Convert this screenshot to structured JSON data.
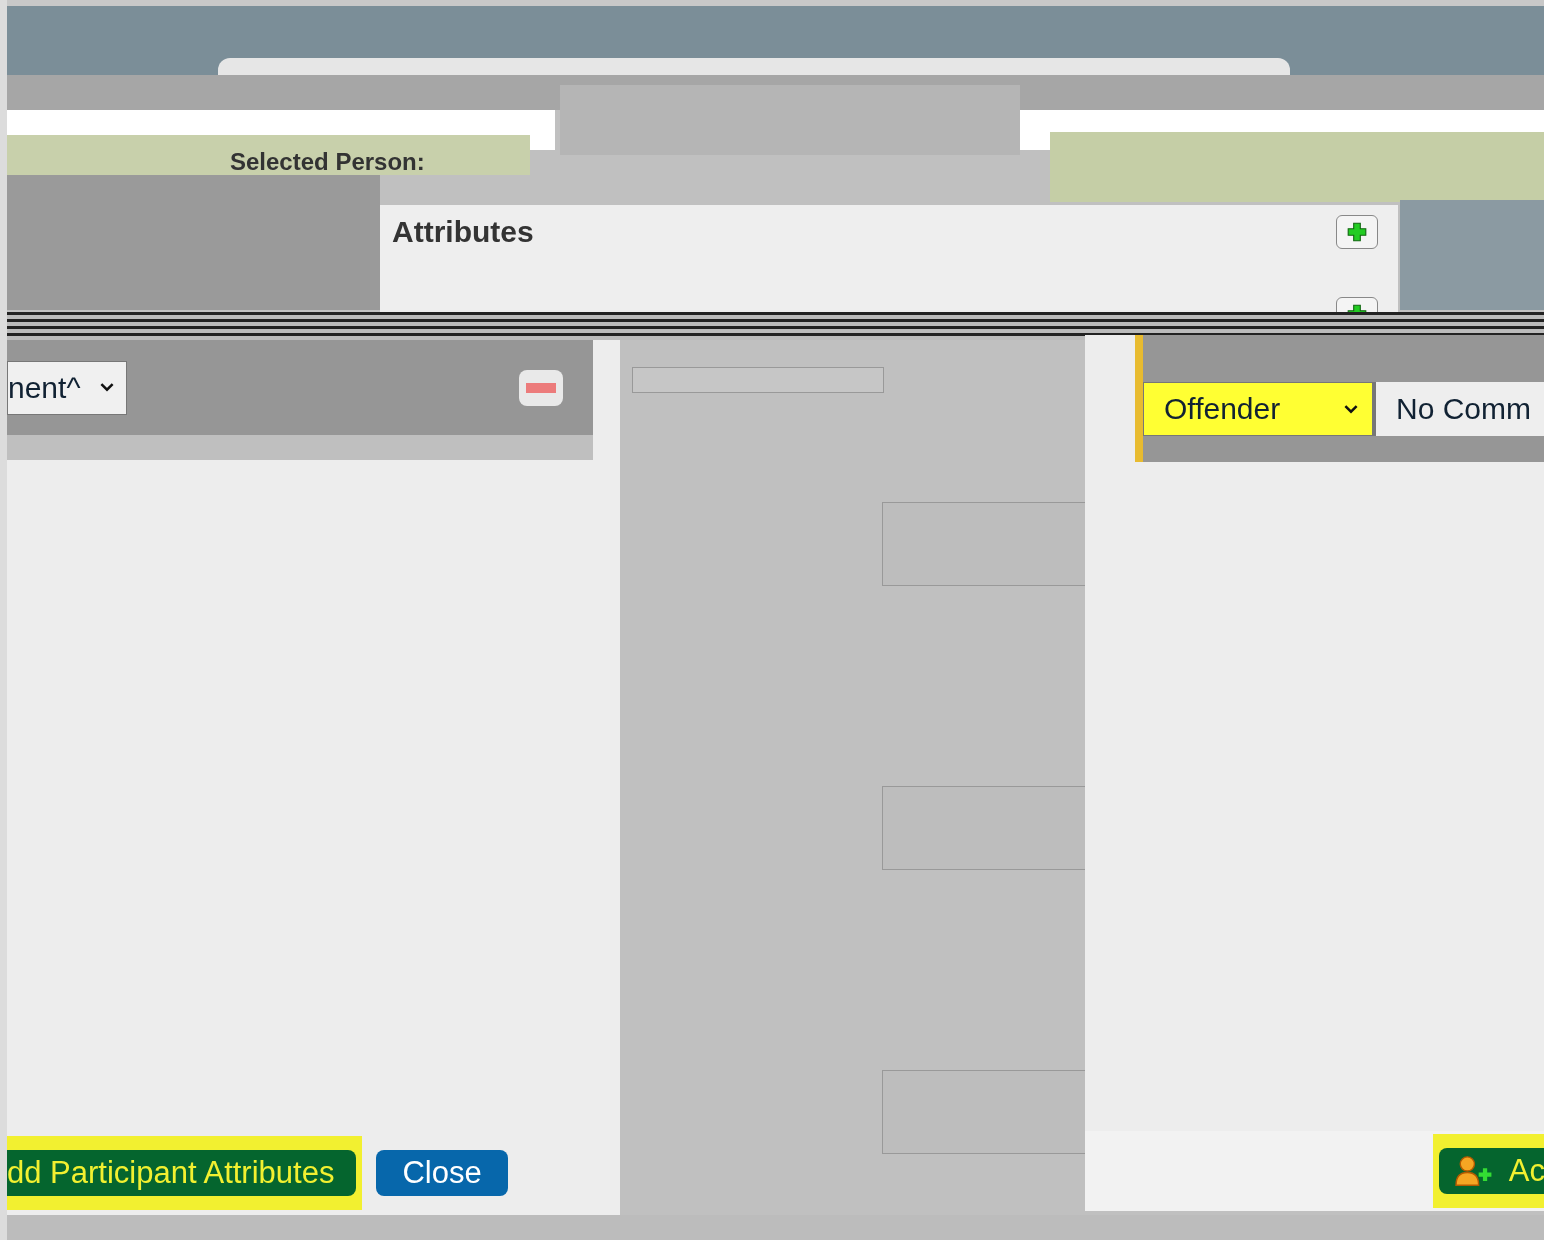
{
  "top_panel": {
    "label": "Selected Person:"
  },
  "attributes_panel": {
    "title": "Attributes"
  },
  "left_dialog": {
    "select_value": "nent^",
    "buttons": [
      {
        "label": "dd Participant Attributes",
        "kind": "primary",
        "highlighted": true
      },
      {
        "label": "Close",
        "kind": "secondary",
        "highlighted": false
      }
    ]
  },
  "right_dialog": {
    "role_select": {
      "value": "Offender",
      "highlighted": true
    },
    "comment_field": {
      "value": "No Comm"
    },
    "add_button": {
      "label": "Ac",
      "highlighted": true
    }
  }
}
